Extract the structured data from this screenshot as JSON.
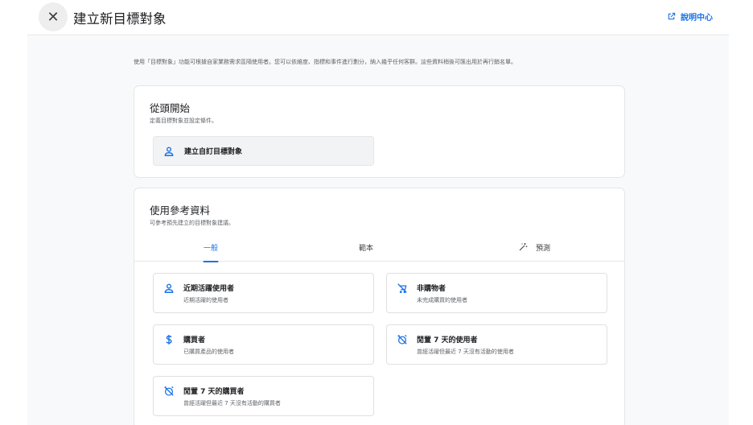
{
  "header": {
    "close_icon": "close-icon",
    "title": "建立新目標對象",
    "help_label": "說明中心",
    "help_icon": "open-in-new-icon"
  },
  "intro_text": "使用「目標對象」功能可根據自家業務需求區隔使用者。您可以依維度、指標和事件進行劃分，納入幾乎任何客群。這些資料稍後可匯出用於再行銷名單。",
  "scratch": {
    "title": "從頭開始",
    "subtitle": "定義目標對象並設定條件。",
    "button_label": "建立自訂目標對象",
    "button_icon": "person-icon"
  },
  "reference": {
    "title": "使用參考資料",
    "subtitle": "可參考預先建立的目標對象建議。",
    "tabs": [
      {
        "label": "一般",
        "active": true
      },
      {
        "label": "範本",
        "active": false
      },
      {
        "label": "預測",
        "active": false,
        "icon": "magic-wand-icon"
      }
    ],
    "options": [
      {
        "title": "近期活躍使用者",
        "desc": "近期活躍的使用者",
        "icon": "person-icon"
      },
      {
        "title": "非購物者",
        "desc": "未完成購買的使用者",
        "icon": "no-shopping-icon"
      },
      {
        "title": "購買者",
        "desc": "已購買產品的使用者",
        "icon": "dollar-icon"
      },
      {
        "title": "閒置 7 天的使用者",
        "desc": "曾經活躍但最近 7 天沒有活動的使用者",
        "icon": "alarm-off-icon"
      },
      {
        "title": "閒置 7 天的購買者",
        "desc": "曾經活躍但最近 7 天沒有活動的購買者",
        "icon": "alarm-off-icon"
      }
    ]
  },
  "colors": {
    "accent": "#1a73e8",
    "background": "#f8f9fa"
  }
}
